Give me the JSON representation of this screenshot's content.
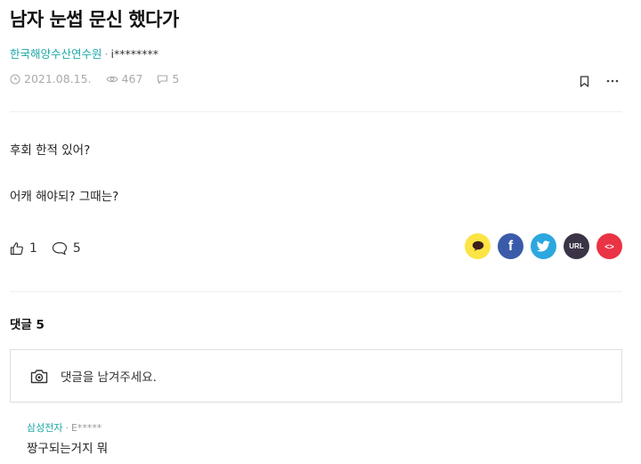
{
  "post": {
    "title": "남자 눈썹 문신 했다가",
    "company": "한국해양수산연수원",
    "separator": "·",
    "user": "i********",
    "date": "2021.08.15.",
    "views": "467",
    "comment_count": "5",
    "body": [
      "후회 한적 있어?",
      "어캐 해야되? 그때는?"
    ]
  },
  "reactions": {
    "likes": "1",
    "comments": "5"
  },
  "share": {
    "kakao": "kakao",
    "facebook": "f",
    "twitter": "twitter",
    "url": "URL",
    "embed": "<>"
  },
  "comments_section": {
    "title": "댓글 5",
    "placeholder": "댓글을 남겨주세요.",
    "items": [
      {
        "company": "삼성전자",
        "separator": "·",
        "user": "E*****",
        "text": "짱구되는거지 뭐"
      }
    ]
  },
  "colors": {
    "accent_teal": "#1ea7a7",
    "kakao": "#fce444",
    "facebook": "#3a5ba9",
    "twitter": "#2ca7e0",
    "url": "#3b3346",
    "embed": "#ea3344"
  }
}
